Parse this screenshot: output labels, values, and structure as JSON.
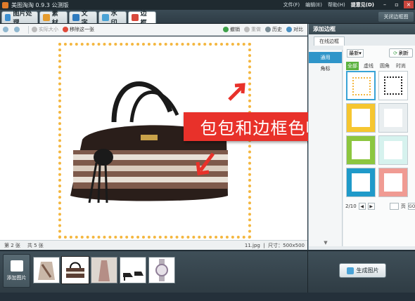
{
  "app": {
    "title": "美图淘淘 0.9.3 公测版"
  },
  "menu": {
    "file": "文件(F)",
    "edit": "编辑(E)",
    "help": "帮助(H)",
    "feedback": "提意见(D)"
  },
  "tabs": [
    {
      "label": "图片处理",
      "color": "#3c8fd0"
    },
    {
      "label": "素材",
      "color": "#e49b2d"
    },
    {
      "label": "文字",
      "color": "#2e7bbf"
    },
    {
      "label": "水印",
      "color": "#4aa3d6"
    },
    {
      "label": "边框",
      "color": "#d8493c",
      "active": true
    }
  ],
  "close_border": "关闭边框图",
  "toolbar": {
    "actual_size": "实际大小",
    "remove_one": "移除这一张",
    "undo": "撤销",
    "redo": "重做",
    "history": "历史",
    "compare": "对比"
  },
  "annotation": {
    "text": "包包和边框色呼应"
  },
  "status": {
    "current": "第 2 张",
    "total": "共 5 张",
    "filename": "11.jpg",
    "size_label": "尺寸：500x500"
  },
  "right_panel": {
    "title": "添加边框",
    "subtab": "在线边框",
    "categories": [
      {
        "label": "通用",
        "active": true
      },
      {
        "label": "角标",
        "active": false
      }
    ],
    "sort": "最新",
    "refresh": "刷新",
    "filters": [
      {
        "label": "全部",
        "active": true
      },
      {
        "label": "虚线"
      },
      {
        "label": "圆角"
      },
      {
        "label": "时尚"
      }
    ],
    "frames": [
      {
        "name": "dotted-star-frame",
        "color": "#f4b740",
        "selected": true
      },
      {
        "name": "black-star-frame",
        "color": "#222222"
      },
      {
        "name": "yellow-frame",
        "color": "#f6c630"
      },
      {
        "name": "white-frame",
        "color": "#e9eef0"
      },
      {
        "name": "green-frame",
        "color": "#8cc63f"
      },
      {
        "name": "mint-frame",
        "color": "#d6f2ee"
      },
      {
        "name": "blue-frame",
        "color": "#1f9ac9"
      },
      {
        "name": "pink-frame",
        "color": "#f09b93"
      }
    ],
    "pager": {
      "page": "2/10",
      "page_unit": "页",
      "go": "GO"
    }
  },
  "bottom": {
    "add_image": "添加图片",
    "generate": "生成图片"
  }
}
